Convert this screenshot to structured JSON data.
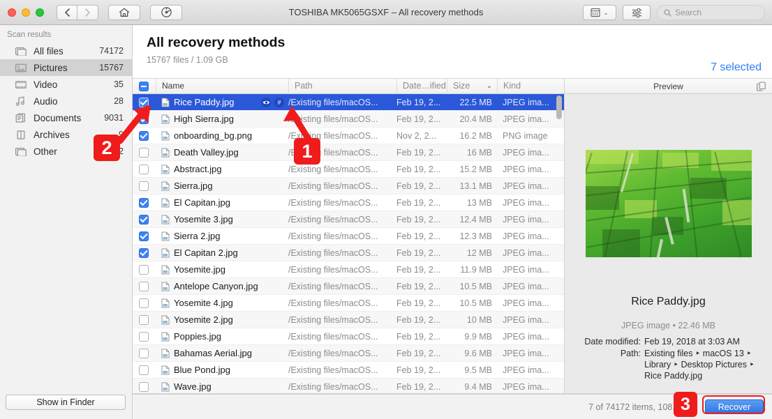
{
  "window": {
    "title": "TOSHIBA MK5065GSXF – All recovery methods",
    "traffic_lights": [
      "close",
      "minimize",
      "zoom"
    ],
    "nav": {
      "back": "‹",
      "forward": "›",
      "home": "home-icon",
      "history": "history-icon"
    },
    "toolbar_right": {
      "view_mode": "list-view-icon",
      "view_chevron": "⌄",
      "filter": "filter-sliders-icon",
      "search_placeholder": "Search",
      "search_value": ""
    }
  },
  "sidebar": {
    "heading": "Scan results",
    "items": [
      {
        "label": "All files",
        "count": "74172",
        "icon": "files-icon",
        "active": false
      },
      {
        "label": "Pictures",
        "count": "15767",
        "icon": "picture-icon",
        "active": true
      },
      {
        "label": "Video",
        "count": "35",
        "icon": "video-icon",
        "active": false
      },
      {
        "label": "Audio",
        "count": "28",
        "icon": "audio-icon",
        "active": false
      },
      {
        "label": "Documents",
        "count": "9031",
        "icon": "documents-icon",
        "active": false
      },
      {
        "label": "Archives",
        "count": "9",
        "icon": "archives-icon",
        "active": false
      },
      {
        "label": "Other",
        "count": "49252",
        "icon": "other-icon",
        "active": false
      }
    ],
    "show_in_finder": "Show in Finder"
  },
  "header": {
    "title": "All recovery methods",
    "subtitle": "15767 files / 1.09 GB",
    "selected_link": "7 selected"
  },
  "table": {
    "columns": [
      "Name",
      "Path",
      "Date…ified",
      "Size",
      "Kind"
    ],
    "sort_indicator": "⌄",
    "header_checkbox": "indeterminate",
    "rows": [
      {
        "checked": true,
        "name": "Rice Paddy.jpg",
        "path": "/Existing files/macOS...",
        "date": "Feb 19, 2...",
        "size": "22.5 MB",
        "kind": "JPEG ima...",
        "selected": true,
        "icons": [
          "eye-icon",
          "hash-icon"
        ]
      },
      {
        "checked": true,
        "name": "High Sierra.jpg",
        "path": "/Existing files/macOS...",
        "date": "Feb 19, 2...",
        "size": "20.4 MB",
        "kind": "JPEG ima...",
        "selected": false
      },
      {
        "checked": true,
        "name": "onboarding_bg.png",
        "path": "/Existing files/macOS...",
        "date": "Nov 2, 2...",
        "size": "16.2 MB",
        "kind": "PNG image",
        "selected": false
      },
      {
        "checked": false,
        "name": "Death Valley.jpg",
        "path": "/Existing files/macOS...",
        "date": "Feb 19, 2...",
        "size": "16 MB",
        "kind": "JPEG ima...",
        "selected": false
      },
      {
        "checked": false,
        "name": "Abstract.jpg",
        "path": "/Existing files/macOS...",
        "date": "Feb 19, 2...",
        "size": "15.2 MB",
        "kind": "JPEG ima...",
        "selected": false
      },
      {
        "checked": false,
        "name": "Sierra.jpg",
        "path": "/Existing files/macOS...",
        "date": "Feb 19, 2...",
        "size": "13.1 MB",
        "kind": "JPEG ima...",
        "selected": false
      },
      {
        "checked": true,
        "name": "El Capitan.jpg",
        "path": "/Existing files/macOS...",
        "date": "Feb 19, 2...",
        "size": "13 MB",
        "kind": "JPEG ima...",
        "selected": false
      },
      {
        "checked": true,
        "name": "Yosemite 3.jpg",
        "path": "/Existing files/macOS...",
        "date": "Feb 19, 2...",
        "size": "12.4 MB",
        "kind": "JPEG ima...",
        "selected": false
      },
      {
        "checked": true,
        "name": "Sierra 2.jpg",
        "path": "/Existing files/macOS...",
        "date": "Feb 19, 2...",
        "size": "12.3 MB",
        "kind": "JPEG ima...",
        "selected": false
      },
      {
        "checked": true,
        "name": "El Capitan 2.jpg",
        "path": "/Existing files/macOS...",
        "date": "Feb 19, 2...",
        "size": "12 MB",
        "kind": "JPEG ima...",
        "selected": false
      },
      {
        "checked": false,
        "name": "Yosemite.jpg",
        "path": "/Existing files/macOS...",
        "date": "Feb 19, 2...",
        "size": "11.9 MB",
        "kind": "JPEG ima...",
        "selected": false
      },
      {
        "checked": false,
        "name": "Antelope Canyon.jpg",
        "path": "/Existing files/macOS...",
        "date": "Feb 19, 2...",
        "size": "10.5 MB",
        "kind": "JPEG ima...",
        "selected": false
      },
      {
        "checked": false,
        "name": "Yosemite 4.jpg",
        "path": "/Existing files/macOS...",
        "date": "Feb 19, 2...",
        "size": "10.5 MB",
        "kind": "JPEG ima...",
        "selected": false
      },
      {
        "checked": false,
        "name": "Yosemite 2.jpg",
        "path": "/Existing files/macOS...",
        "date": "Feb 19, 2...",
        "size": "10 MB",
        "kind": "JPEG ima...",
        "selected": false
      },
      {
        "checked": false,
        "name": "Poppies.jpg",
        "path": "/Existing files/macOS...",
        "date": "Feb 19, 2...",
        "size": "9.9 MB",
        "kind": "JPEG ima...",
        "selected": false
      },
      {
        "checked": false,
        "name": "Bahamas Aerial.jpg",
        "path": "/Existing files/macOS...",
        "date": "Feb 19, 2...",
        "size": "9.6 MB",
        "kind": "JPEG ima...",
        "selected": false
      },
      {
        "checked": false,
        "name": "Blue Pond.jpg",
        "path": "/Existing files/macOS...",
        "date": "Feb 19, 2...",
        "size": "9.5 MB",
        "kind": "JPEG ima...",
        "selected": false
      },
      {
        "checked": false,
        "name": "Wave.jpg",
        "path": "/Existing files/macOS...",
        "date": "Feb 19, 2...",
        "size": "9.4 MB",
        "kind": "JPEG ima...",
        "selected": false
      }
    ]
  },
  "preview": {
    "heading": "Preview",
    "copy_icon": "copy-icon",
    "image_alt": "rice-paddy-aerial-photo",
    "filename": "Rice Paddy.jpg",
    "meta": "JPEG image • 22.46 MB",
    "fields": [
      {
        "key": "Date modified:",
        "value": "Feb 19, 2018 at 3:03 AM"
      },
      {
        "key": "Path:",
        "value": "Existing files ‣ macOS 13 ‣ Library ‣ Desktop Pictures ‣ Rice Paddy.jpg"
      }
    ]
  },
  "status": {
    "text": "7 of 74172 items, 108.7 MB",
    "recover_label": "Recover"
  },
  "annotations": [
    {
      "id": "1",
      "label": "1"
    },
    {
      "id": "2",
      "label": "2"
    },
    {
      "id": "3",
      "label": "3"
    }
  ],
  "colors": {
    "accent_blue": "#2d7ff9",
    "selection_blue": "#2b58d8",
    "checkbox_blue": "#3b82f6",
    "annotation_red": "#f01b1b",
    "recover_blue": "#2f74e0"
  }
}
